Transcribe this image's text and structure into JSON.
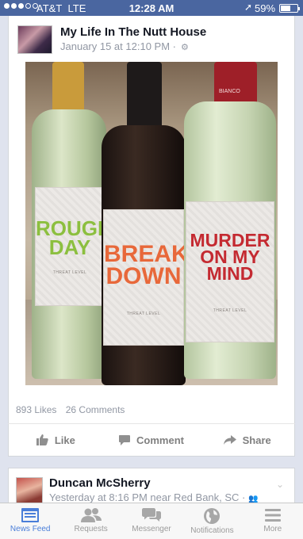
{
  "status_bar": {
    "carrier": "AT&T",
    "network": "LTE",
    "time": "12:28 AM",
    "battery_text": "59%",
    "battery_level": 0.59
  },
  "post": {
    "author": "My Life In The Nutt House",
    "timestamp": "January 15 at 12:10 PM ·",
    "photo": {
      "bottle_1": {
        "label_title": "ROUGH DAY",
        "threat_level": "THREAT LEVEL",
        "color": "#8cbf3f"
      },
      "bottle_2": {
        "label_title": "BREAK DOWN",
        "threat_level": "THREAT LEVEL",
        "color": "#e8683a"
      },
      "bottle_3": {
        "label_title": "MURDER ON MY MIND",
        "threat_level": "THREAT LEVEL",
        "color": "#c42a31"
      },
      "foil_text": "BIANCO"
    },
    "likes": "893 Likes",
    "comments": "26 Comments",
    "actions": {
      "like": "Like",
      "comment": "Comment",
      "share": "Share"
    }
  },
  "next_post": {
    "author": "Duncan McSherry",
    "meta": "Yesterday at 8:16 PM near Red Bank, SC ·"
  },
  "tab_bar": {
    "news_feed": "News Feed",
    "requests": "Requests",
    "messenger": "Messenger",
    "notifications": "Notifications",
    "more": "More"
  },
  "colors": {
    "facebook_blue": "#4a66a0",
    "active_tab": "#4a7ed9"
  }
}
